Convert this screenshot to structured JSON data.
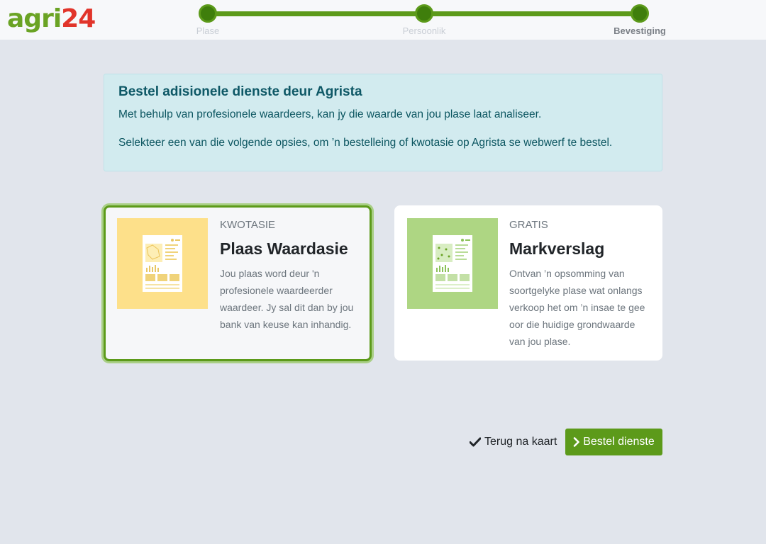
{
  "brand": {
    "part1": "agri",
    "part2": "24"
  },
  "stepper": {
    "steps": [
      {
        "label": "Plase",
        "state": "done"
      },
      {
        "label": "Persoonlik",
        "state": "done"
      },
      {
        "label": "Bevestiging",
        "state": "active"
      }
    ]
  },
  "info": {
    "title": "Bestel adisionele dienste deur Agrista",
    "p1": "Met behulp van profesionele waardeers, kan jy die waarde van jou plase laat analiseer.",
    "p2": "Selekteer een van die volgende opsies, om ’n bestelleing of kwotasie op Agrista se webwerf te bestel."
  },
  "cards": [
    {
      "kicker": "KWOTASIE",
      "title": "Plaas Waardasie",
      "description": "Jou plaas word deur 'n profesionele waardeerder waardeer. Jy sal dit dan by jou bank van keuse kan inhandig.",
      "image_bg": "#fde08a",
      "selected": true
    },
    {
      "kicker": "GRATIS",
      "title": "Markverslag",
      "description": "Ontvan ’n opsomming van soortgelyke plase wat onlangs verkoop het om ’n insae te gee oor die huidige grondwaarde van jou plase.",
      "image_bg": "#aed683",
      "selected": false
    }
  ],
  "actions": {
    "back_label": "Terug na kaart",
    "order_label": "Bestel dienste"
  },
  "colors": {
    "accent": "#5c9a1a",
    "info_bg": "#d2ebef",
    "page_bg": "#e1e5ec"
  }
}
